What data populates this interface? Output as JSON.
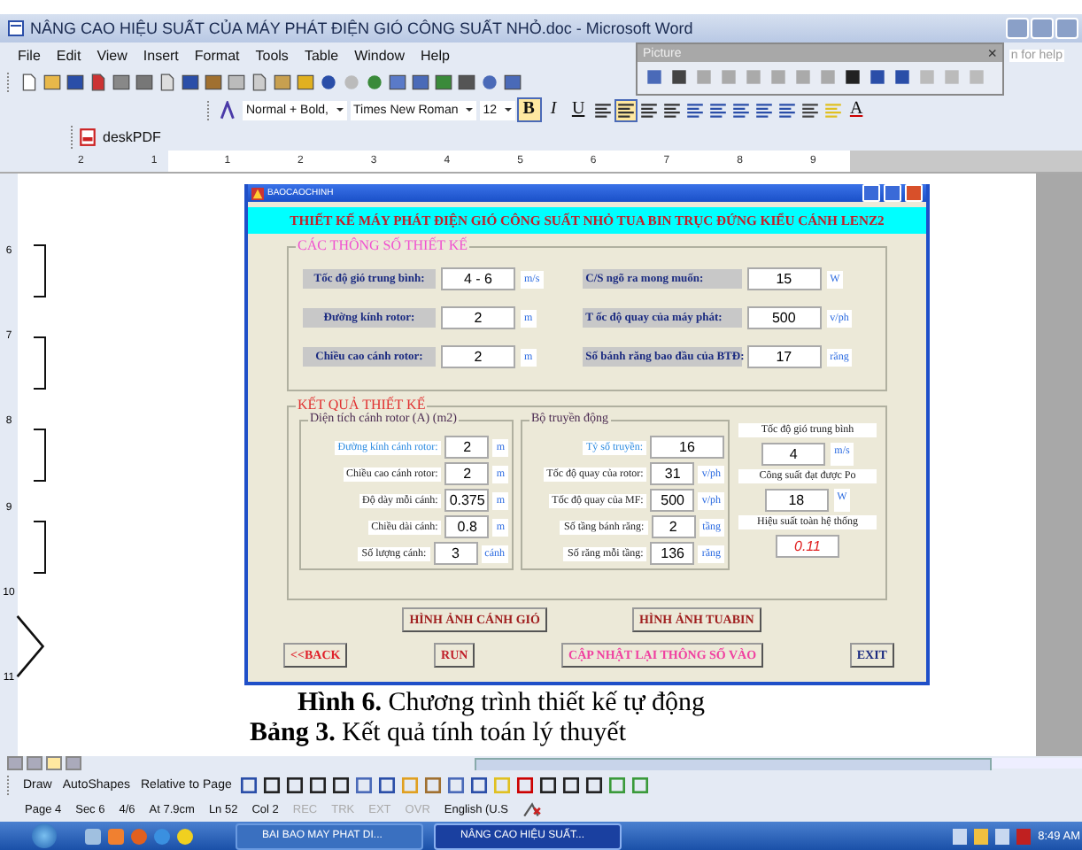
{
  "window": {
    "title": "NÂNG CAO HIỆU SUẤT CỦA MÁY PHÁT ĐIỆN GIÓ CÔNG SUẤT NHỎ.doc - Microsoft Word"
  },
  "menu": [
    "File",
    "Edit",
    "View",
    "Insert",
    "Format",
    "Tools",
    "Table",
    "Window",
    "Help"
  ],
  "help_box": {
    "placeholder": "n for help"
  },
  "formatting": {
    "style": "Normal + Bold,",
    "font": "Times New Roman",
    "size": "12",
    "bold": "B",
    "italic": "I",
    "underline": "U",
    "font_color": "A"
  },
  "pdf_toolbar": {
    "label": "deskPDF"
  },
  "picture_toolbar": {
    "title": "Picture",
    "close": "×"
  },
  "ruler": [
    "2",
    "1",
    "1",
    "2",
    "3",
    "4",
    "5",
    "6",
    "7",
    "8",
    "9"
  ],
  "vertical_ruler": [
    "6",
    "7",
    "8",
    "9",
    "10",
    "11"
  ],
  "dialog": {
    "title": "BAOCAOCHINH",
    "header": "THIẾT KẾ  MÁY PHÁT ĐIỆN GIÓ CÔNG SUẤT NHỎ TUA BIN TRỤC ĐỨNG KIỂU CÁNH LENZ2",
    "inputs": {
      "title": "CÁC THÔNG SỐ THIẾT KẾ",
      "left": [
        {
          "label": "Tốc độ gió trung bình:",
          "value": "4 - 6",
          "unit": "m/s"
        },
        {
          "label": "Đường kính rotor:",
          "value": "2",
          "unit": "m"
        },
        {
          "label": "Chiều cao cánh rotor:",
          "value": "2",
          "unit": "m"
        }
      ],
      "right": [
        {
          "label": "C/S ngõ ra mong muốn:",
          "value": "15",
          "unit": "W"
        },
        {
          "label": "T ốc độ quay của máy phát:",
          "value": "500",
          "unit": "v/ph"
        },
        {
          "label": "Số bánh răng bao đầu của BTĐ:",
          "value": "17",
          "unit": "răng"
        }
      ]
    },
    "results": {
      "title": "KẾT QUẢ THIẾT KẾ",
      "area": {
        "title": "Diện tích cánh rotor (A) (m2)",
        "rows": [
          {
            "label": "Đường kính cánh rotor:",
            "value": "2",
            "unit": "m",
            "highlighted": true
          },
          {
            "label": "Chiều cao cánh rotor:",
            "value": "2",
            "unit": "m",
            "highlighted": false
          },
          {
            "label": "Độ dày mỗi cánh:",
            "value": "0.375",
            "unit": "m",
            "highlighted": false
          },
          {
            "label": "Chiều dài cánh:",
            "value": "0.8",
            "unit": "m",
            "highlighted": false
          },
          {
            "label": "Số lượng cánh:",
            "value": "3",
            "unit": "cánh",
            "highlighted": false
          }
        ]
      },
      "drive": {
        "title": "Bộ truyền động",
        "rows": [
          {
            "label": "Tỷ số truyền:",
            "value": "16",
            "highlighted": true
          },
          {
            "label": "Tốc độ quay của rotor:",
            "value": "31",
            "unit": "v/ph",
            "highlighted": false
          },
          {
            "label": "Tốc độ quay của MF:",
            "value": "500",
            "unit": "v/ph",
            "highlighted": false
          },
          {
            "label": "Số tầng bánh răng:",
            "value": "2",
            "unit": "tầng",
            "highlighted": false
          },
          {
            "label": "Số răng mỗi tầng:",
            "value": "136",
            "unit": "răng",
            "highlighted": false
          }
        ]
      },
      "summary": [
        {
          "label": "Tốc độ gió trung bình",
          "value": "4",
          "unit": "m/s",
          "highlighted": false
        },
        {
          "label": "Công suất đạt được Po",
          "value": "18",
          "unit": "W",
          "highlighted": false
        },
        {
          "label": "Hiệu suất toàn hệ thống",
          "value": "0.11",
          "highlighted": true
        }
      ]
    },
    "image_buttons": [
      "HÌNH ẢNH CÁNH GIÓ",
      "HÌNH ẢNH TUABIN"
    ],
    "action_buttons": [
      {
        "label": "<<BACK",
        "color": "#e0202a"
      },
      {
        "label": "RUN",
        "color": "#c0202a"
      },
      {
        "label": "CẬP NHẬT LẠI THÔNG SỐ VÀO",
        "color": "#f040a0"
      },
      {
        "label": "EXIT",
        "color": "#1a2a80"
      }
    ]
  },
  "captions": [
    "**Hình 6.** Chương trình thiết kế tự động",
    "**Bảng 3.** Kết quả tính toán lý thuyết"
  ],
  "drawing_toolbar": {
    "draw": "Draw",
    "autoshapes": "AutoShapes",
    "relative": "Relative to Page"
  },
  "status_bar": [
    {
      "text": "Page 4",
      "disabled": false
    },
    {
      "text": "Sec 6",
      "disabled": false
    },
    {
      "text": "4/6",
      "disabled": false
    },
    {
      "text": "At 7.9cm",
      "disabled": false
    },
    {
      "text": "Ln 52",
      "disabled": false
    },
    {
      "text": "Col 2",
      "disabled": false
    },
    {
      "text": "REC",
      "disabled": true
    },
    {
      "text": "TRK",
      "disabled": true
    },
    {
      "text": "EXT",
      "disabled": true
    },
    {
      "text": "OVR",
      "disabled": true
    },
    {
      "text": "English (U.S",
      "disabled": false
    }
  ],
  "taskbar": {
    "tasks": [
      {
        "label": "BAI BAO MAY PHAT DI...",
        "selected": false
      },
      {
        "label": "NÂNG CAO HIỆU SUẤT...",
        "selected": true
      }
    ],
    "clock": "8:49 AM"
  }
}
